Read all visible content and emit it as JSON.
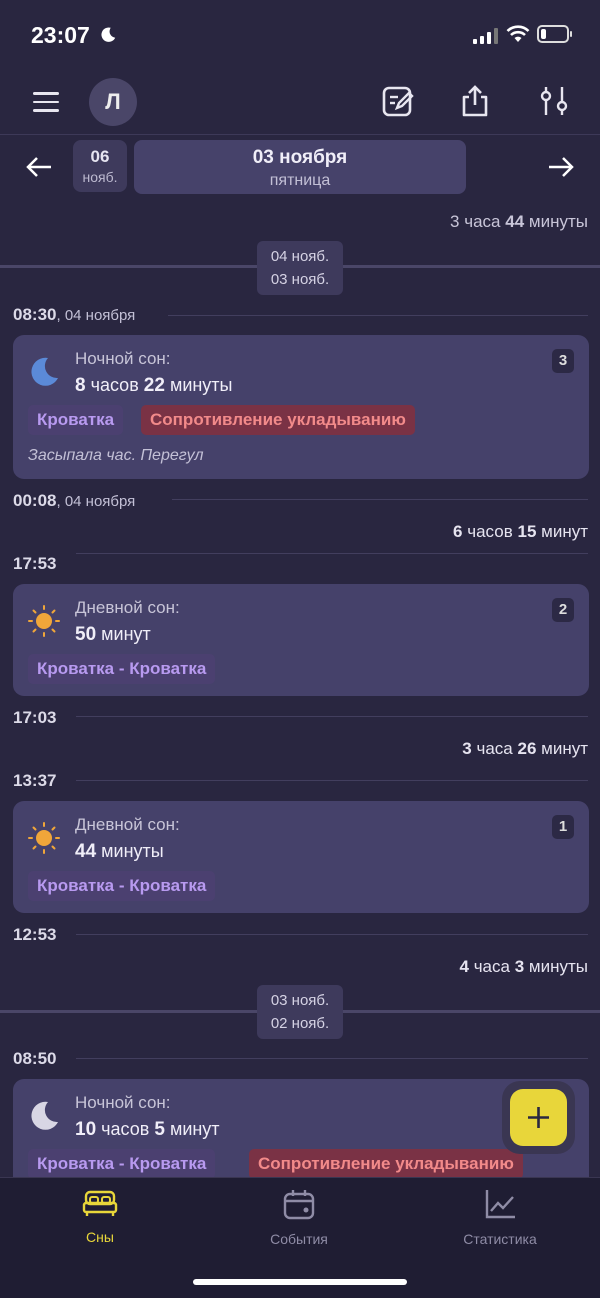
{
  "status_bar": {
    "time": "23:07"
  },
  "top_bar": {
    "avatar_letter": "Л"
  },
  "date_nav": {
    "prev_day": "06",
    "prev_month": "нояб.",
    "current_date": "03 ноября",
    "current_weekday": "пятница"
  },
  "wake_windows": [
    {
      "h": "3",
      "h_unit": "часа",
      "m": "44",
      "m_unit": "минуты"
    },
    {
      "h": "6",
      "h_unit": "часов",
      "m": "15",
      "m_unit": "минут"
    },
    {
      "h": "3",
      "h_unit": "часа",
      "m": "26",
      "m_unit": "минут"
    },
    {
      "h": "4",
      "h_unit": "часа",
      "m": "3",
      "m_unit": "минуты"
    }
  ],
  "day_separators": [
    {
      "top": "04 нояб.",
      "bottom": "03 нояб."
    },
    {
      "top": "03 нояб.",
      "bottom": "02 нояб."
    }
  ],
  "times": {
    "t1": "08:30",
    "t1_date": ", 04 ноября",
    "t2": "00:08",
    "t2_date": ", 04 ноября",
    "t3": "17:53",
    "t4": "17:03",
    "t5": "13:37",
    "t6": "12:53",
    "t7": "08:50"
  },
  "sleeps": [
    {
      "type": "Ночной сон:",
      "h": "8",
      "h_unit": "часов",
      "m": "22",
      "m_unit": "минуты",
      "number": "3",
      "place": "Кроватка",
      "tag": "Сопротивление укладыванию",
      "note": "Засыпала час. Перегул"
    },
    {
      "type": "Дневной сон:",
      "m": "50",
      "m_unit": "минут",
      "number": "2",
      "place": "Кроватка - Кроватка"
    },
    {
      "type": "Дневной сон:",
      "m": "44",
      "m_unit": "минуты",
      "number": "1",
      "place": "Кроватка - Кроватка"
    },
    {
      "type": "Ночной сон:",
      "h": "10",
      "h_unit": "часов",
      "m": "5",
      "m_unit": "минут",
      "place": "Кроватка - Кроватка",
      "tag": "Сопротивление укладыванию"
    }
  ],
  "fab": {
    "label": "+"
  },
  "bottom_nav": {
    "tabs": [
      {
        "label": "Сны",
        "icon": "bed-icon"
      },
      {
        "label": "События",
        "icon": "calendar-icon"
      },
      {
        "label": "Статистика",
        "icon": "chart-icon"
      }
    ]
  },
  "colors": {
    "background": "#292640",
    "card": "#45416a",
    "accent": "#e8d63a",
    "tag_place": "#b89af0",
    "tag_alert": "#f28a8a"
  }
}
